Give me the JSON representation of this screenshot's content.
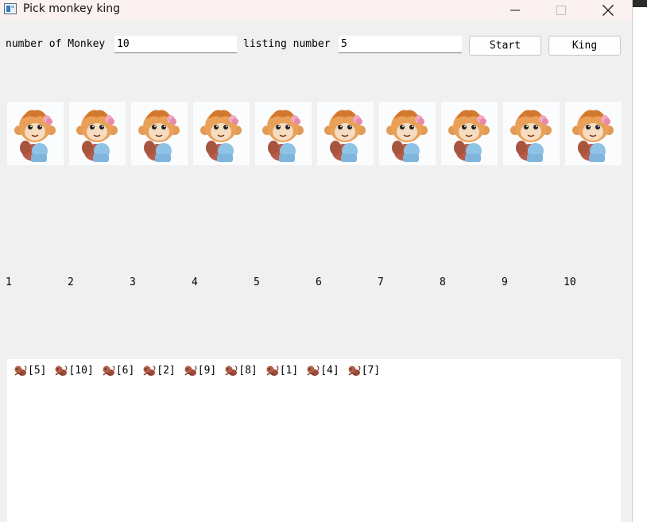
{
  "window": {
    "title": "Pick monkey king",
    "minimize_icon": "minimize-icon",
    "maximize_icon": "maximize-icon",
    "close_icon": "close-icon"
  },
  "form": {
    "monkey_count_label": "number of Monkey",
    "monkey_count_value": "10",
    "listing_label": "listing number",
    "listing_value": "5",
    "start_label": "Start",
    "king_label": "King"
  },
  "monkeys": [
    "1",
    "2",
    "3",
    "4",
    "5",
    "6",
    "7",
    "8",
    "9",
    "10"
  ],
  "monkey_image_icon": "monkey-cartoon-icon",
  "output": {
    "entries": [
      "[5]",
      "[10]",
      "[6]",
      "[2]",
      "[9]",
      "[8]",
      "[1]",
      "[4]",
      "[7]"
    ],
    "entry_icon": "monkey-small-icon"
  },
  "colors": {
    "window_bg": "#f0f0f0",
    "titlebar_bg": "#fbf1f0",
    "monkey_fur": "#e9a15a",
    "monkey_shirt": "#8fc3e6"
  }
}
